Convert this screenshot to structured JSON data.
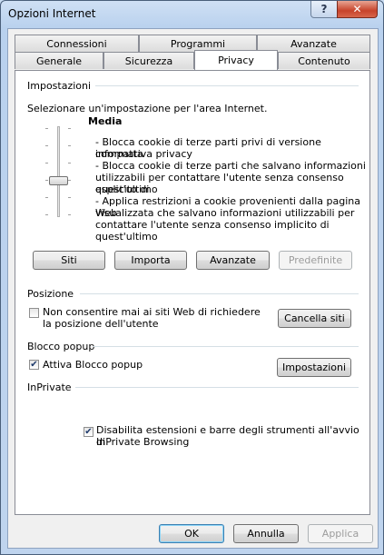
{
  "window": {
    "title": "Opzioni Internet",
    "help_glyph": "?",
    "close_glyph": "✕"
  },
  "tabs_back": [
    "Connessioni",
    "Programmi",
    "Avanzate"
  ],
  "tabs_front": [
    "Generale",
    "Sicurezza",
    "Privacy",
    "Contenuto"
  ],
  "active_tab": "Privacy",
  "settings": {
    "group_label": "Impostazioni",
    "instruction": "Selezionare un'impostazione per l'area Internet.",
    "level_title": "Media",
    "descriptions": [
      "- Blocca cookie di terze parti privi di versione compatta",
      "informativa privacy",
      "- Blocca cookie di terze parti che salvano informazioni",
      "utilizzabili per contattare l'utente senza consenso esplicito di",
      "quest'ultimo",
      "- Applica restrizioni a cookie provenienti dalla pagina Web",
      "visualizzata che salvano informazioni utilizzabili per",
      "contattare l'utente senza consenso implicito di quest'ultimo"
    ],
    "buttons": {
      "sites": "Siti",
      "import": "Importa",
      "advanced": "Avanzate",
      "default": "Predefinite"
    }
  },
  "location": {
    "group_label": "Posizione",
    "checkbox_line1": "Non consentire mai ai siti Web di richiedere",
    "checkbox_line2": "la posizione dell'utente",
    "checked": false,
    "clear_button": "Cancella siti"
  },
  "popup": {
    "group_label": "Blocco popup",
    "checkbox_label": "Attiva Blocco popup",
    "checked": true,
    "settings_button": "Impostazioni"
  },
  "inprivate": {
    "group_label": "InPrivate",
    "checkbox_line1": "Disabilita estensioni e barre degli strumenti all'avvio di",
    "checkbox_line2": "InPrivate Browsing",
    "checked": true
  },
  "footer": {
    "ok": "OK",
    "cancel": "Annulla",
    "apply": "Applica"
  }
}
